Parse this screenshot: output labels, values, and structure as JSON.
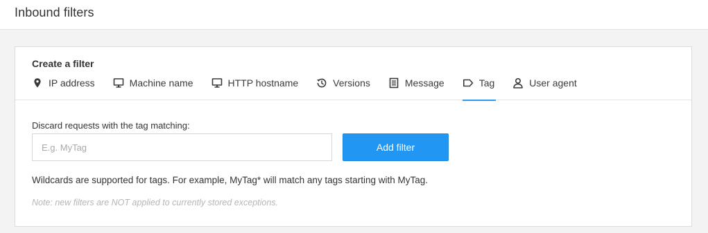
{
  "page": {
    "title": "Inbound filters"
  },
  "card": {
    "heading": "Create a filter",
    "tabs": [
      {
        "label": "IP address",
        "icon": "map-pin-icon",
        "active": false
      },
      {
        "label": "Machine name",
        "icon": "monitor-icon",
        "active": false
      },
      {
        "label": "HTTP hostname",
        "icon": "monitor-icon",
        "active": false
      },
      {
        "label": "Versions",
        "icon": "history-icon",
        "active": false
      },
      {
        "label": "Message",
        "icon": "document-icon",
        "active": false
      },
      {
        "label": "Tag",
        "icon": "tag-icon",
        "active": true
      },
      {
        "label": "User agent",
        "icon": "user-icon",
        "active": false
      }
    ]
  },
  "form": {
    "label": "Discard requests with the tag matching:",
    "input_value": "",
    "placeholder": "E.g. MyTag",
    "button_label": "Add filter",
    "help": "Wildcards are supported for tags. For example, MyTag* will match any tags starting with MyTag.",
    "note": "Note: new filters are NOT applied to currently stored exceptions."
  },
  "colors": {
    "accent": "#2b9af3",
    "button": "#2196f3",
    "background": "#f3f3f3"
  }
}
